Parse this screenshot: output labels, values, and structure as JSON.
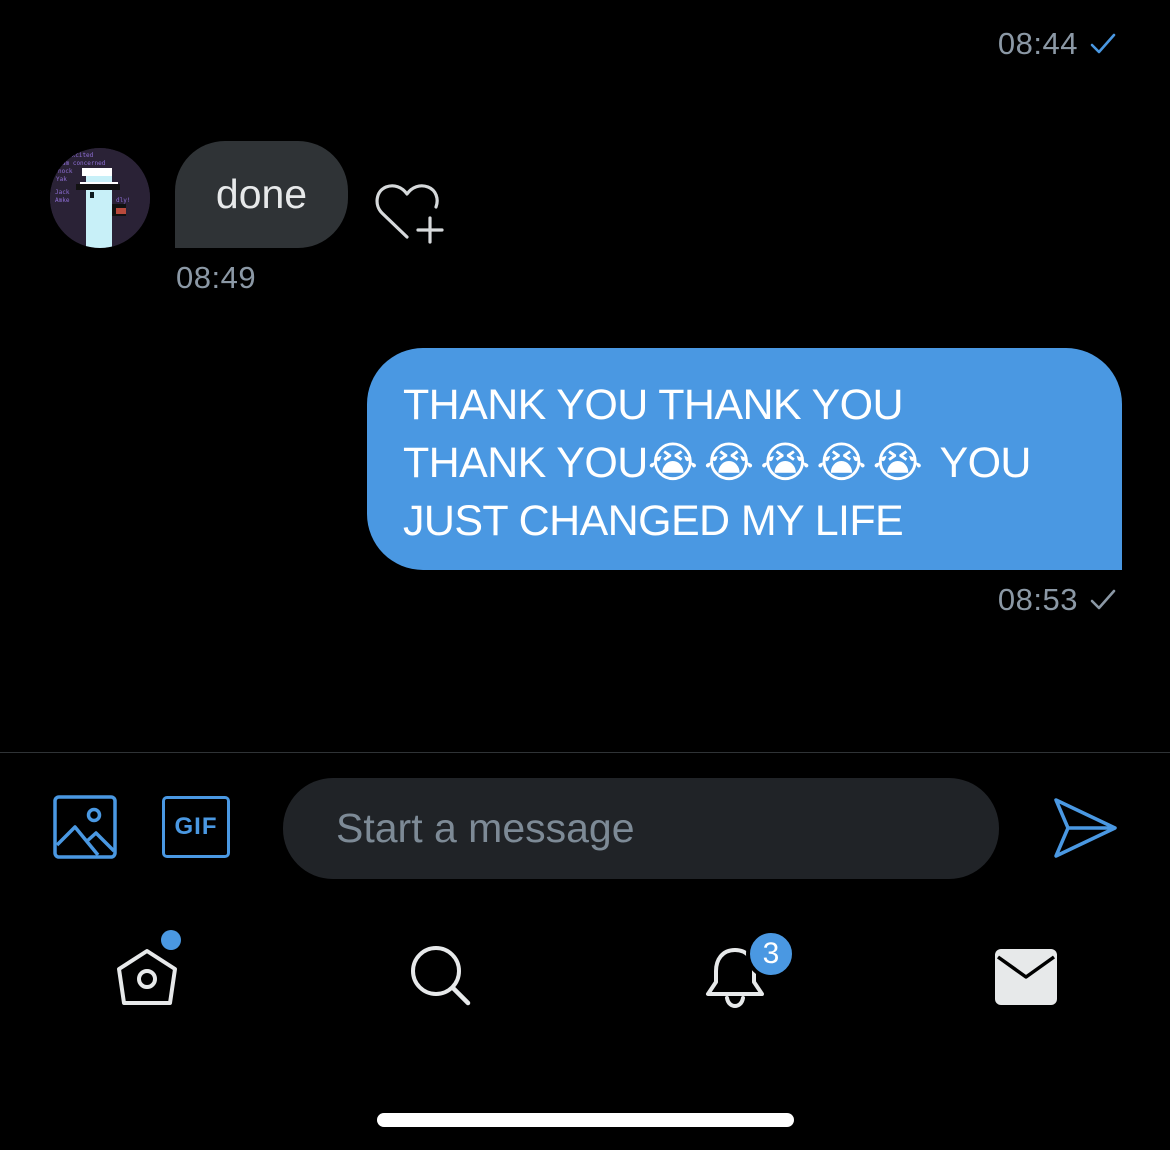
{
  "conversation": {
    "top_timestamp": "08:44",
    "received": {
      "text": "done",
      "timestamp": "08:49",
      "react_icon": "heart-plus-icon",
      "avatar_text": [
        "excited",
        "am concerned",
        "nock",
        "Yak",
        "Jack",
        "Amke",
        "dly!"
      ]
    },
    "sent": {
      "line1": "THANK YOU THANK YOU",
      "line2_prefix": "THANK YOU",
      "emojis": "😭😭😭😭😭",
      "line2_suffix": "YOU",
      "line3": "JUST CHANGED MY LIFE",
      "timestamp": "08:53"
    }
  },
  "composer": {
    "placeholder": "Start a message",
    "gif_label": "GIF",
    "media_icon": "image-icon",
    "send_icon": "send-icon"
  },
  "tabbar": {
    "items": [
      "home",
      "search",
      "notifications",
      "messages"
    ],
    "notification_count": "3"
  },
  "colors": {
    "accent": "#4a98e2",
    "bubble_in": "#2f3336",
    "composer_bg": "#202327",
    "muted_text": "#8b98a5"
  }
}
